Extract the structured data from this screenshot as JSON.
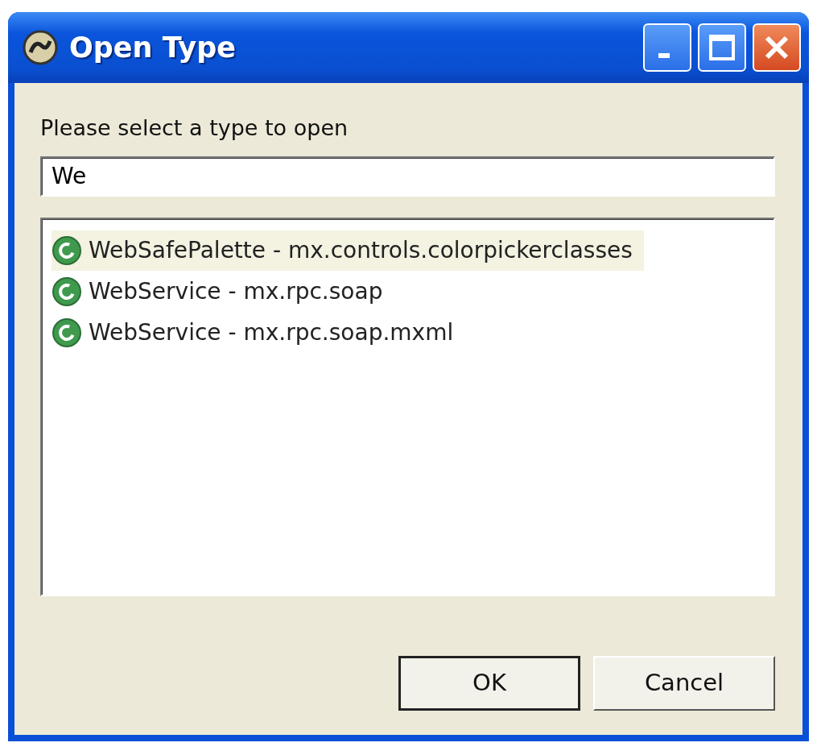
{
  "window": {
    "title": "Open Type"
  },
  "prompt": "Please select a type to open",
  "filter": {
    "value": "We"
  },
  "types": [
    {
      "name": "WebSafePalette - mx.controls.colorpickerclasses",
      "selected": true
    },
    {
      "name": "WebService - mx.rpc.soap",
      "selected": false
    },
    {
      "name": "WebService - mx.rpc.soap.mxml",
      "selected": false
    }
  ],
  "buttons": [
    {
      "label": "OK",
      "default": true
    },
    {
      "label": "Cancel",
      "default": false
    }
  ]
}
